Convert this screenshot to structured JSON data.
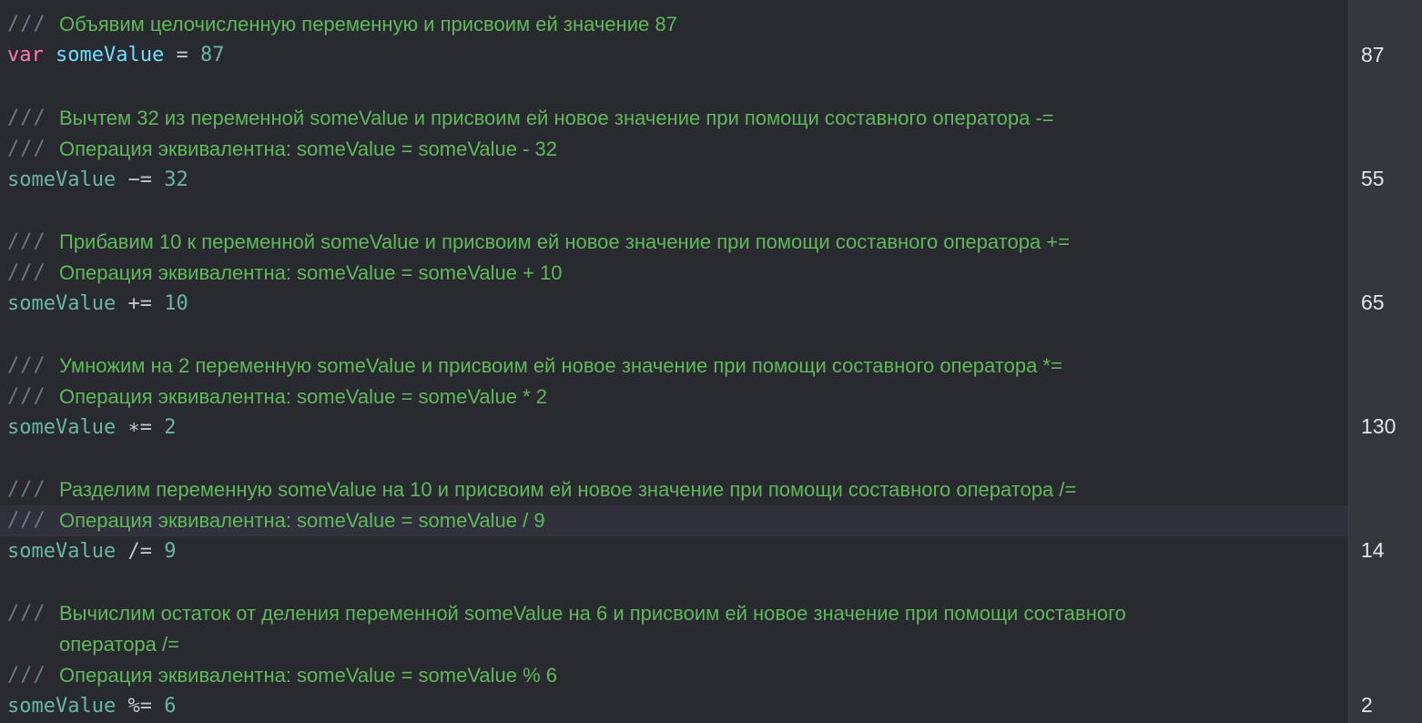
{
  "editor": {
    "blocks": [
      {
        "comments": [
          "Объявим целочисленную переменную и присвоим ей значение 87"
        ],
        "code": {
          "keyword": "var",
          "variable": "someValue",
          "operator": "=",
          "number": "87"
        },
        "result": "87"
      },
      {
        "comments": [
          "Вычтем 32 из переменной someValue и присвоим ей новое значение при помощи составного оператора -=",
          "Операция эквивалентна: someValue = someValue - 32"
        ],
        "code": {
          "variable": "someValue",
          "operator": "−=",
          "number": "32"
        },
        "result": "55"
      },
      {
        "comments": [
          "Прибавим 10 к переменной someValue и присвоим ей новое значение при помощи составного оператора +=",
          "Операция эквивалентна: someValue = someValue + 10"
        ],
        "code": {
          "variable": "someValue",
          "operator": "+=",
          "number": "10"
        },
        "result": "65"
      },
      {
        "comments": [
          "Умножим на 2 переменную someValue и присвоим ей новое значение при помощи составного оператора *=",
          "Операция эквивалентна: someValue = someValue * 2"
        ],
        "code": {
          "variable": "someValue",
          "operator": "∗=",
          "number": "2"
        },
        "result": "130"
      },
      {
        "comments": [
          "Разделим переменную someValue на 10 и присвоим ей новое значение при помощи составного оператора /=",
          "Операция эквивалентна: someValue = someValue / 9"
        ],
        "code": {
          "variable": "someValue",
          "operator": "/=",
          "number": "9"
        },
        "result": "14"
      },
      {
        "comments": [
          "Вычислим остаток от деления переменной someValue на 6 и присвоим ей новое значение при помощи составного",
          "оператора /=",
          "Операция эквивалентна: someValue = someValue % 6"
        ],
        "code": {
          "variable": "someValue",
          "operator": "%=",
          "number": "6"
        },
        "result": "2"
      }
    ],
    "comment_prefix": "///"
  },
  "colors": {
    "background": "#292a30",
    "results_background": "#36373d",
    "comment": "#5fb95a",
    "comment_slashes": "#6c7986",
    "keyword": "#ff7ab2",
    "declared_identifier": "#6bdfff",
    "variable": "#67b7a4",
    "number": "#67b7a4",
    "result_text": "#e4e4e6",
    "current_line": "#30313c"
  }
}
